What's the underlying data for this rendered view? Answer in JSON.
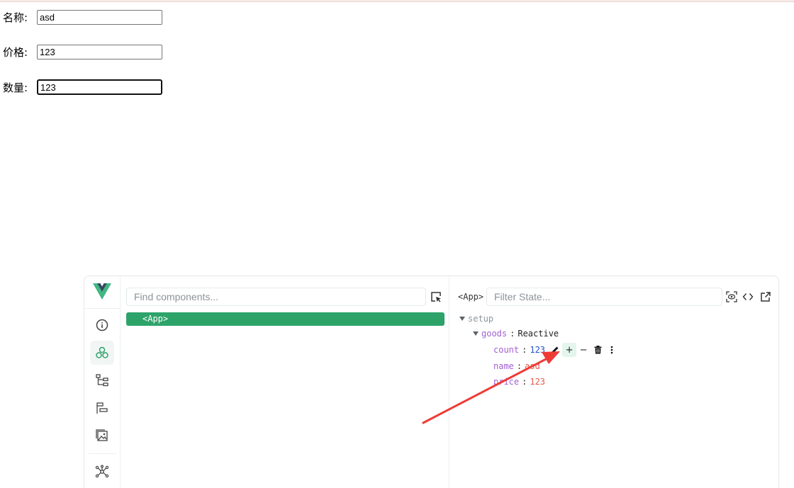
{
  "form": {
    "name_label": "名称:",
    "name_value": "asd",
    "price_label": "价格:",
    "price_value": "123",
    "count_label": "数量:",
    "count_value": "123"
  },
  "devtools": {
    "rail_icons": [
      "vue-logo-icon",
      "info-icon",
      "components-icon",
      "component-tree-icon",
      "timeline-icon",
      "assets-icon",
      "router-graph-icon"
    ],
    "accent_color": "#2da36a",
    "component_search_placeholder": "Find components...",
    "tree": [
      {
        "label": "<App>",
        "selected": true
      }
    ],
    "selected_component": "<App>",
    "filter_state_placeholder": "Filter State...",
    "state": {
      "section": "setup",
      "object_key": "goods",
      "object_type": "Reactive",
      "props": [
        {
          "key": "count",
          "value": "123",
          "kind": "number"
        },
        {
          "key": "name",
          "value": "asd",
          "kind": "string"
        },
        {
          "key": "price",
          "value": "123",
          "kind": "string"
        }
      ],
      "actions": [
        "edit-icon",
        "increment-icon",
        "decrement-icon",
        "delete-icon",
        "more-icon"
      ],
      "increment_label": "+",
      "decrement_label": "−"
    }
  }
}
